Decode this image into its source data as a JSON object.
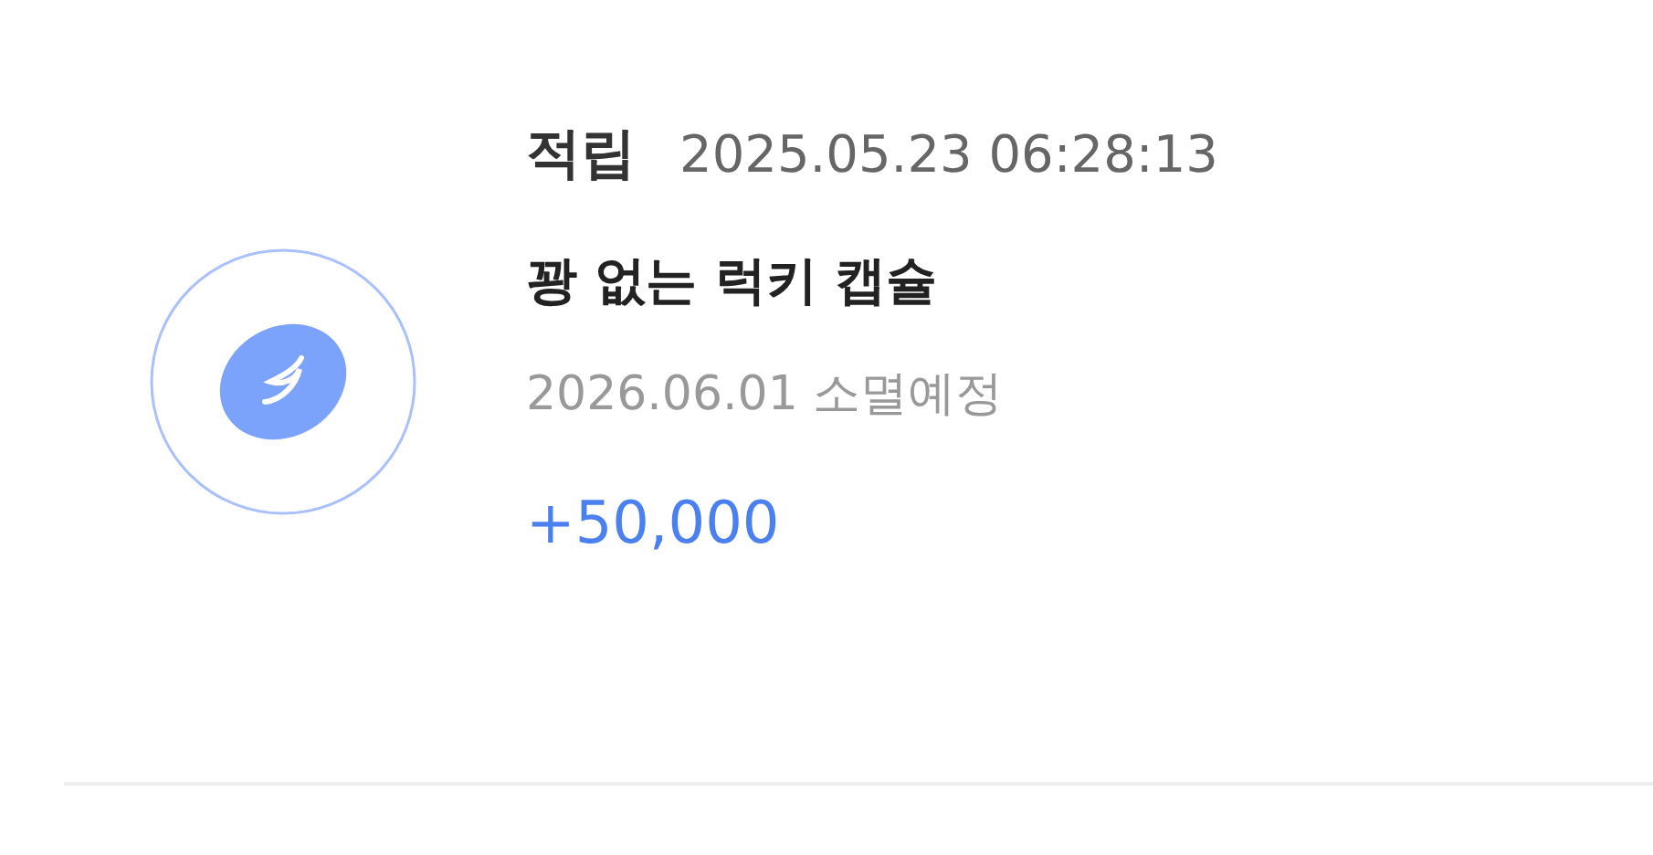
{
  "entry": {
    "type": "적립",
    "datetime": "2025.05.23 06:28:13",
    "name": "꽝 없는 럭키 캡슐",
    "expiry": "2026.06.01 소멸예정",
    "amount": "+50,000"
  }
}
